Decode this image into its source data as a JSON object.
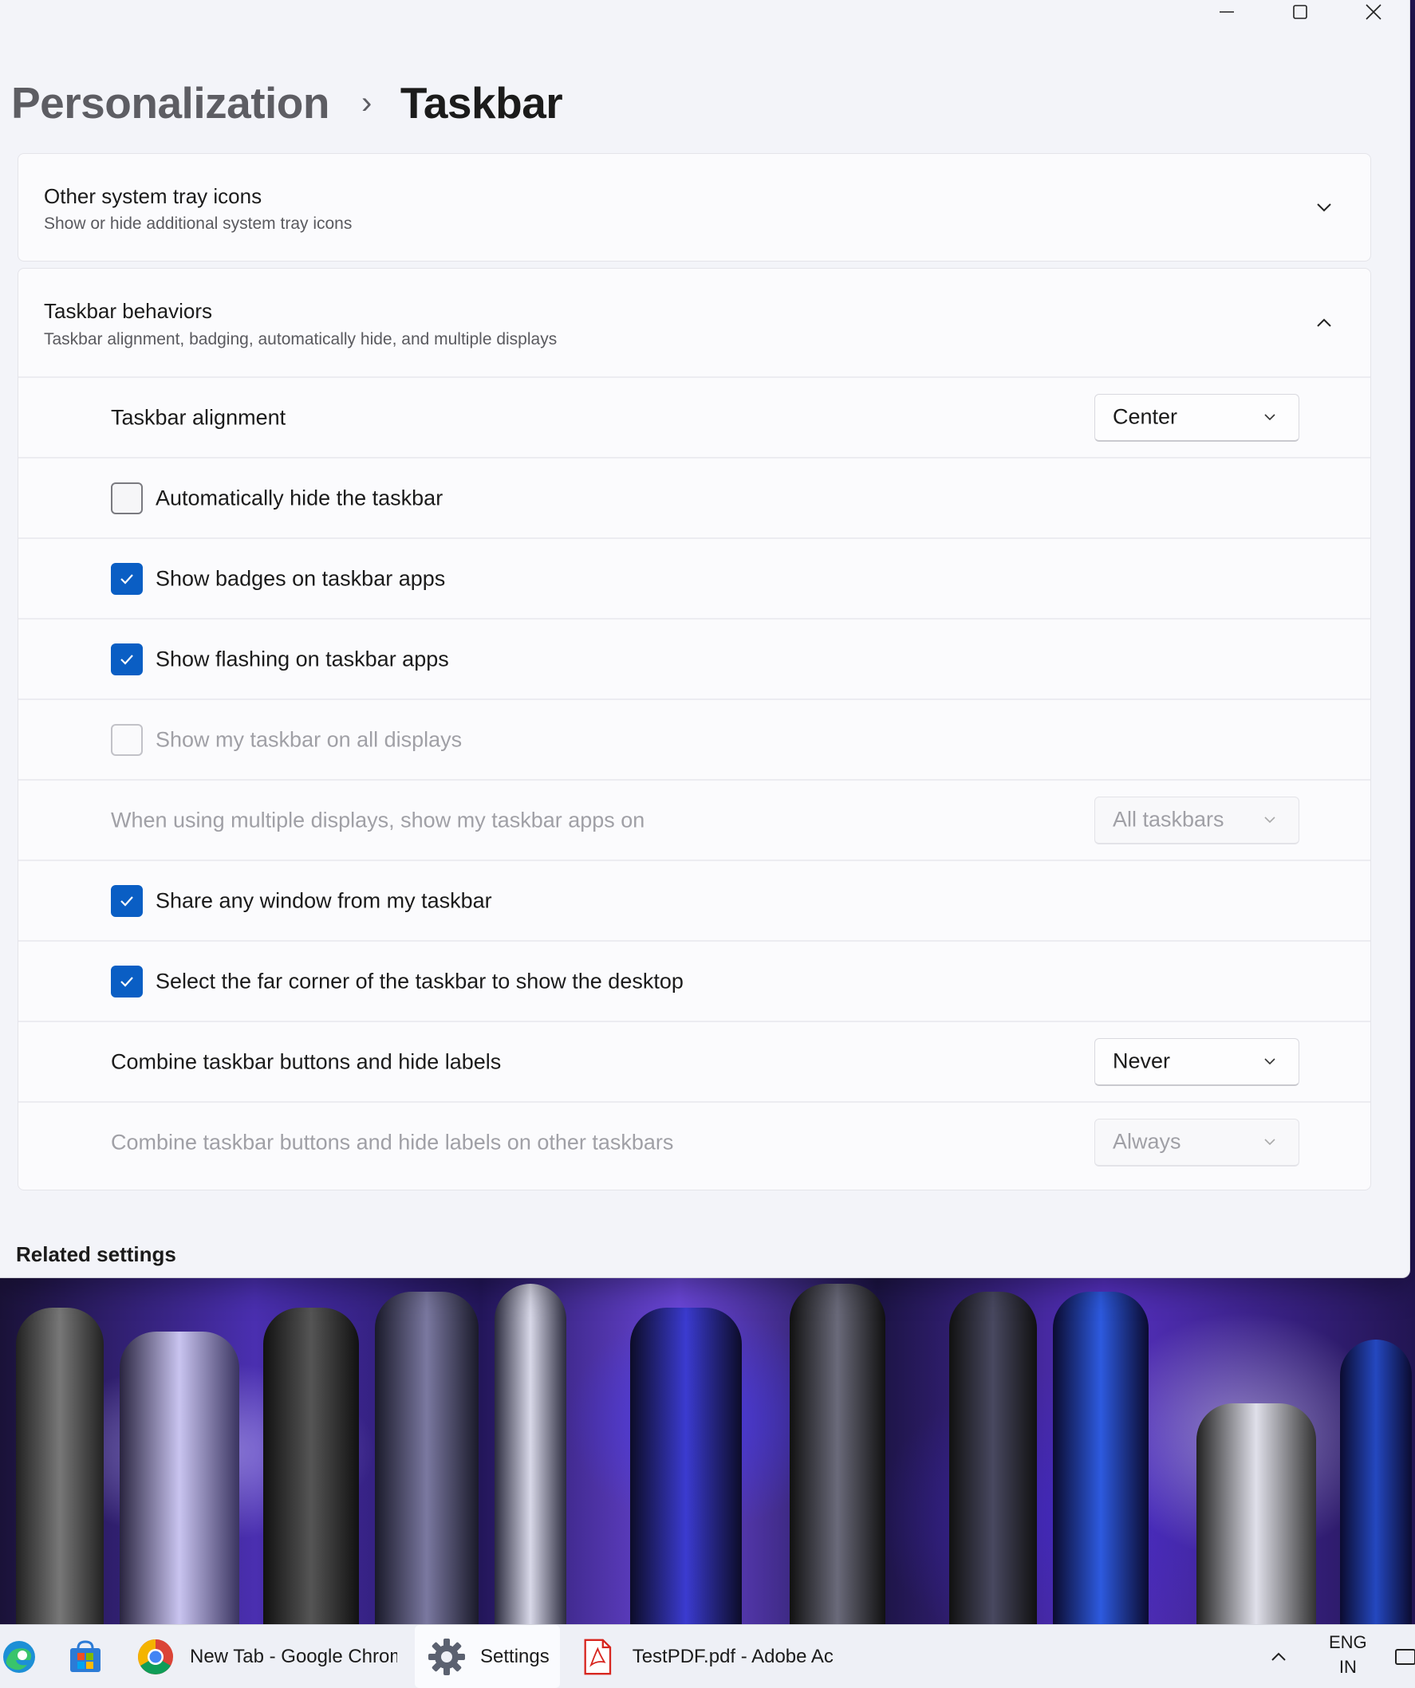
{
  "window": {
    "controls": {
      "minimize": "minimize",
      "maximize": "maximize",
      "close": "close"
    }
  },
  "breadcrumb": {
    "parent": "Personalization",
    "separator": "›",
    "current": "Taskbar"
  },
  "tray_card": {
    "title": "Other system tray icons",
    "subtitle": "Show or hide additional system tray icons",
    "expanded": false
  },
  "behaviors_card": {
    "title": "Taskbar behaviors",
    "subtitle": "Taskbar alignment, badging, automatically hide, and multiple displays",
    "expanded": true,
    "alignment": {
      "label": "Taskbar alignment",
      "value": "Center"
    },
    "auto_hide": {
      "label": "Automatically hide the taskbar",
      "checked": false
    },
    "badges": {
      "label": "Show badges on taskbar apps",
      "checked": true
    },
    "flashing": {
      "label": "Show flashing on taskbar apps",
      "checked": true
    },
    "all_displays": {
      "label": "Show my taskbar on all displays",
      "checked": false,
      "disabled": true
    },
    "multi_display": {
      "label": "When using multiple displays, show my taskbar apps on",
      "value": "All taskbars",
      "disabled": true
    },
    "share_window": {
      "label": "Share any window from my taskbar",
      "checked": true
    },
    "far_corner": {
      "label": "Select the far corner of the taskbar to show the desktop",
      "checked": true
    },
    "combine": {
      "label": "Combine taskbar buttons and hide labels",
      "value": "Never"
    },
    "combine_other": {
      "label": "Combine taskbar buttons and hide labels on other taskbars",
      "value": "Always",
      "disabled": true
    }
  },
  "related_settings": {
    "heading": "Related settings"
  },
  "taskbar": {
    "apps": [
      {
        "name": "edge",
        "icon": "edge-icon"
      },
      {
        "name": "store",
        "icon": "store-icon"
      },
      {
        "name": "chrome",
        "icon": "chrome-icon",
        "label": "New Tab - Google Chrome"
      },
      {
        "name": "settings",
        "icon": "gear-icon",
        "label": "Settings",
        "active": true
      },
      {
        "name": "acrobat",
        "icon": "pdf-icon",
        "label": "TestPDF.pdf - Adobe Ac"
      }
    ],
    "tray": {
      "lang_line1": "ENG",
      "lang_line2": "IN"
    }
  },
  "colors": {
    "accent": "#0a5ec4",
    "window_bg": "#f3f4f9",
    "card_bg": "#fbfbfd",
    "disabled_text": "#a0a0a6"
  }
}
